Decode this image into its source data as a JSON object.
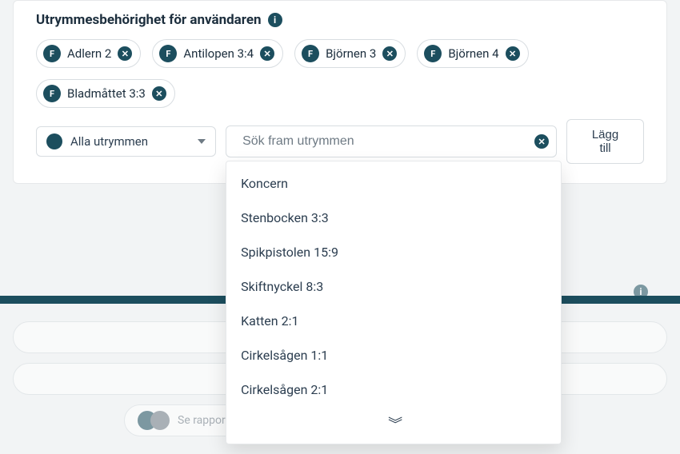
{
  "section": {
    "title": "Utrymmesbehörighet för användaren"
  },
  "chips": [
    {
      "badge": "F",
      "label": "Adlern 2"
    },
    {
      "badge": "F",
      "label": "Antilopen 3:4"
    },
    {
      "badge": "F",
      "label": "Björnen 3"
    },
    {
      "badge": "F",
      "label": "Björnen 4"
    },
    {
      "badge": "F",
      "label": "Bladmåttet 3:3"
    }
  ],
  "scope_select": {
    "label": "Alla utrymmen"
  },
  "search": {
    "placeholder": "Sök fram utrymmen"
  },
  "add_button": "Lägg till",
  "dropdown": {
    "items": [
      "Koncern",
      "Stenbocken 3:3",
      "Spikpistolen 15:9",
      "Skiftnyckel 8:3",
      "Katten 2:1",
      "Cirkelsågen 1:1",
      "Cirkelsågen 2:1"
    ],
    "more_glyph": "︾"
  },
  "ghost": {
    "label": "Se rapporter"
  }
}
